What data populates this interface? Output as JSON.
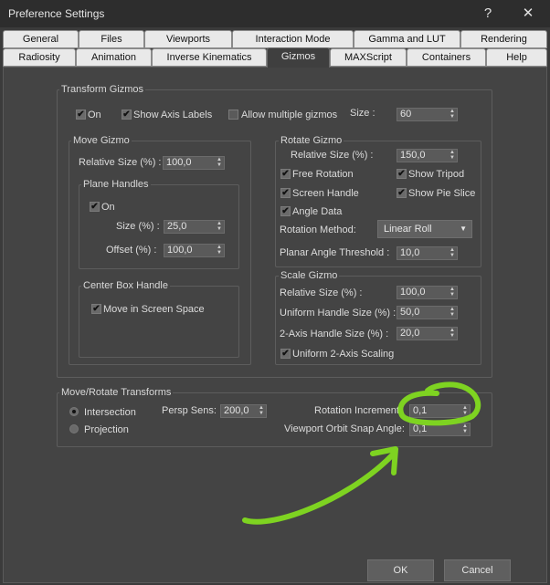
{
  "window": {
    "title": "Preference Settings",
    "help": "?",
    "close": "✕"
  },
  "tabs_row1": [
    "General",
    "Files",
    "Viewports",
    "Interaction Mode",
    "Gamma and LUT",
    "Rendering"
  ],
  "tabs_row2": [
    "Radiosity",
    "Animation",
    "Inverse Kinematics",
    "Gizmos",
    "MAXScript",
    "Containers",
    "Help"
  ],
  "active_tab": "Gizmos",
  "transform_gizmos": {
    "title": "Transform Gizmos",
    "on": {
      "label": "On",
      "checked": true
    },
    "show_axis_labels": {
      "label": "Show Axis Labels",
      "checked": true
    },
    "allow_multiple": {
      "label": "Allow multiple gizmos",
      "checked": false
    },
    "size_label": "Size :",
    "size_value": "60"
  },
  "move_gizmo": {
    "title": "Move Gizmo",
    "relative_size_label": "Relative Size (%) :",
    "relative_size_value": "100,0",
    "plane_handles": {
      "title": "Plane Handles",
      "on_label": "On",
      "size_label": "Size (%) :",
      "size_value": "25,0",
      "offset_label": "Offset (%) :",
      "offset_value": "100,0"
    },
    "center_box": {
      "title": "Center Box Handle",
      "move_label": "Move in Screen Space"
    }
  },
  "rotate_gizmo": {
    "title": "Rotate Gizmo",
    "relative_size_label": "Relative Size (%) :",
    "relative_size_value": "150,0",
    "free_rotation": "Free Rotation",
    "show_tripod": "Show Tripod",
    "screen_handle": "Screen Handle",
    "show_pie_slice": "Show Pie Slice",
    "angle_data": "Angle Data",
    "rotation_method_label": "Rotation Method:",
    "rotation_method_value": "Linear Roll",
    "planar_label": "Planar Angle Threshold :",
    "planar_value": "10,0"
  },
  "scale_gizmo": {
    "title": "Scale Gizmo",
    "relative_size_label": "Relative Size (%) :",
    "relative_size_value": "100,0",
    "uniform_handle_label": "Uniform Handle Size (%) :",
    "uniform_handle_value": "50,0",
    "two_axis_label": "2-Axis Handle Size (%) :",
    "two_axis_value": "20,0",
    "uniform_2axis": "Uniform 2-Axis Scaling"
  },
  "move_rotate": {
    "title": "Move/Rotate Transforms",
    "intersection": "Intersection",
    "projection": "Projection",
    "persp_sens_label": "Persp Sens:",
    "persp_sens_value": "200,0",
    "rotation_increment_label": "Rotation Increment:",
    "rotation_increment_value": "0,1",
    "orbit_snap_label": "Viewport Orbit Snap Angle:",
    "orbit_snap_value": "0,1"
  },
  "buttons": {
    "ok": "OK",
    "cancel": "Cancel"
  },
  "colors": {
    "annotation": "#7ed321"
  }
}
